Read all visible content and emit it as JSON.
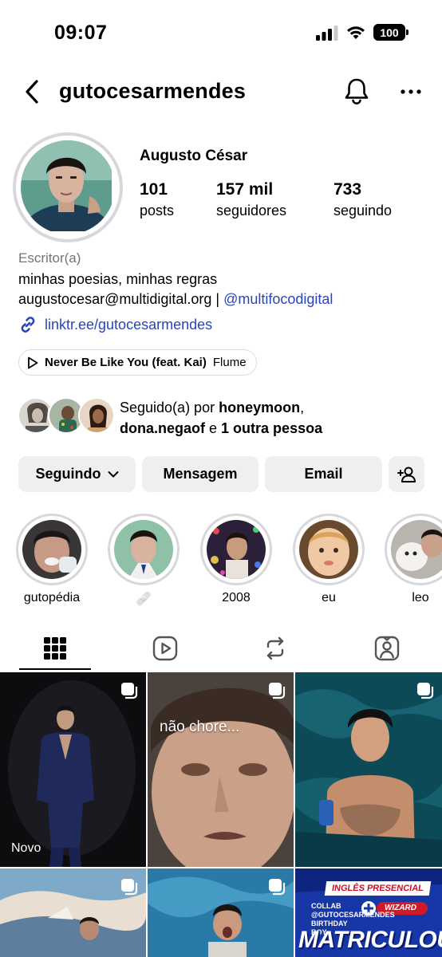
{
  "status_bar": {
    "time": "09:07",
    "battery": "100"
  },
  "header": {
    "username": "gutocesarmendes"
  },
  "profile": {
    "display_name": "Augusto César",
    "stats": [
      {
        "value": "101",
        "label": "posts"
      },
      {
        "value": "157 mil",
        "label": "seguidores"
      },
      {
        "value": "733",
        "label": "seguindo"
      }
    ],
    "category": "Escritor(a)",
    "bio_line1": "minhas poesias, minhas regras",
    "bio_email": "augustocesar@multidigital.org |",
    "bio_mention": "@multifocodigital",
    "link": "linktr.ee/gutocesarmendes",
    "music_title": "Never Be Like You (feat. Kai)",
    "music_artist": "Flume"
  },
  "followed_by": {
    "prefix": "Seguido(a) por",
    "name1": "honeymoon",
    "comma": ",",
    "name2": "dona.negaof",
    "and": "e",
    "others": "1 outra pessoa"
  },
  "actions": {
    "following": "Seguindo",
    "message": "Mensagem",
    "email": "Email"
  },
  "highlights": [
    {
      "label": "gutopédia"
    },
    {
      "label": "🩹"
    },
    {
      "label": "2008"
    },
    {
      "label": "eu"
    },
    {
      "label": "leo"
    }
  ],
  "grid": {
    "post1_caption": "Novo",
    "post2_caption": "não chore...",
    "ad_header": "INGLÊS PRESENCIAL",
    "ad_small": "COLLAB @GUTOCESARMENDES BIRTHDAY BOY",
    "ad_brand": "WIZARD",
    "ad_title": "MATRICULOU?"
  },
  "colors": {
    "link_blue": "#2b45b8",
    "button_bg": "#efeff2",
    "ring_gray": "#d8d8dc",
    "secondary_text": "#737373"
  },
  "icons": [
    "signal-icon",
    "wifi-icon",
    "battery-icon",
    "back-icon",
    "bell-icon",
    "more-icon",
    "link-icon",
    "play-icon",
    "chevron-down-icon",
    "add-person-icon",
    "grid-icon",
    "reels-icon",
    "reposts-icon",
    "tagged-icon",
    "multi-post-icon"
  ]
}
